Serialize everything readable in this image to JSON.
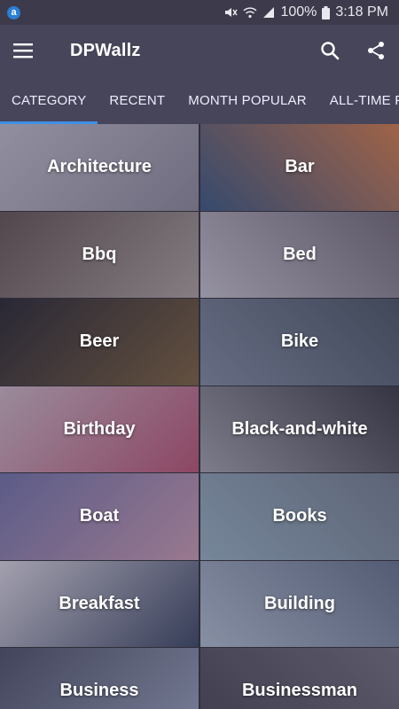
{
  "status_bar": {
    "app_badge": "a",
    "battery": "100%",
    "time": "3:18 PM"
  },
  "app_bar": {
    "title": "DPWallz"
  },
  "tabs": [
    {
      "label": "CATEGORY",
      "active": true
    },
    {
      "label": "RECENT",
      "active": false
    },
    {
      "label": "MONTH POPULAR",
      "active": false
    },
    {
      "label": "ALL-TIME POPULAR",
      "active": false
    }
  ],
  "categories": [
    {
      "label": "Architecture",
      "tones": [
        "#c9c6cf",
        "#8e8a98"
      ]
    },
    {
      "label": "Bar",
      "tones": [
        "#2b4f7a",
        "#e07b3a"
      ]
    },
    {
      "label": "Bbq",
      "tones": [
        "#5b4a40",
        "#b3a79d"
      ]
    },
    {
      "label": "Bed",
      "tones": [
        "#cfcbd3",
        "#6e6670"
      ]
    },
    {
      "label": "Beer",
      "tones": [
        "#16151a",
        "#7a5a2a"
      ]
    },
    {
      "label": "Bike",
      "tones": [
        "#7f8da0",
        "#3f4c57"
      ]
    },
    {
      "label": "Birthday",
      "tones": [
        "#d7bfc8",
        "#c04a6a"
      ]
    },
    {
      "label": "Black-and-white",
      "tones": [
        "#a7a7ad",
        "#2b2b30"
      ]
    },
    {
      "label": "Boat",
      "tones": [
        "#6c6ea8",
        "#d6a0b3"
      ]
    },
    {
      "label": "Books",
      "tones": [
        "#9ab8c6",
        "#6f7c8a"
      ]
    },
    {
      "label": "Breakfast",
      "tones": [
        "#e7e4ea",
        "#2d3a55"
      ]
    },
    {
      "label": "Building",
      "tones": [
        "#b7c7d6",
        "#5f6e86"
      ]
    },
    {
      "label": "Business",
      "tones": [
        "#41465a",
        "#9aa7bd"
      ]
    },
    {
      "label": "Businessman",
      "tones": [
        "#3c3b45",
        "#6e6a74"
      ]
    }
  ]
}
